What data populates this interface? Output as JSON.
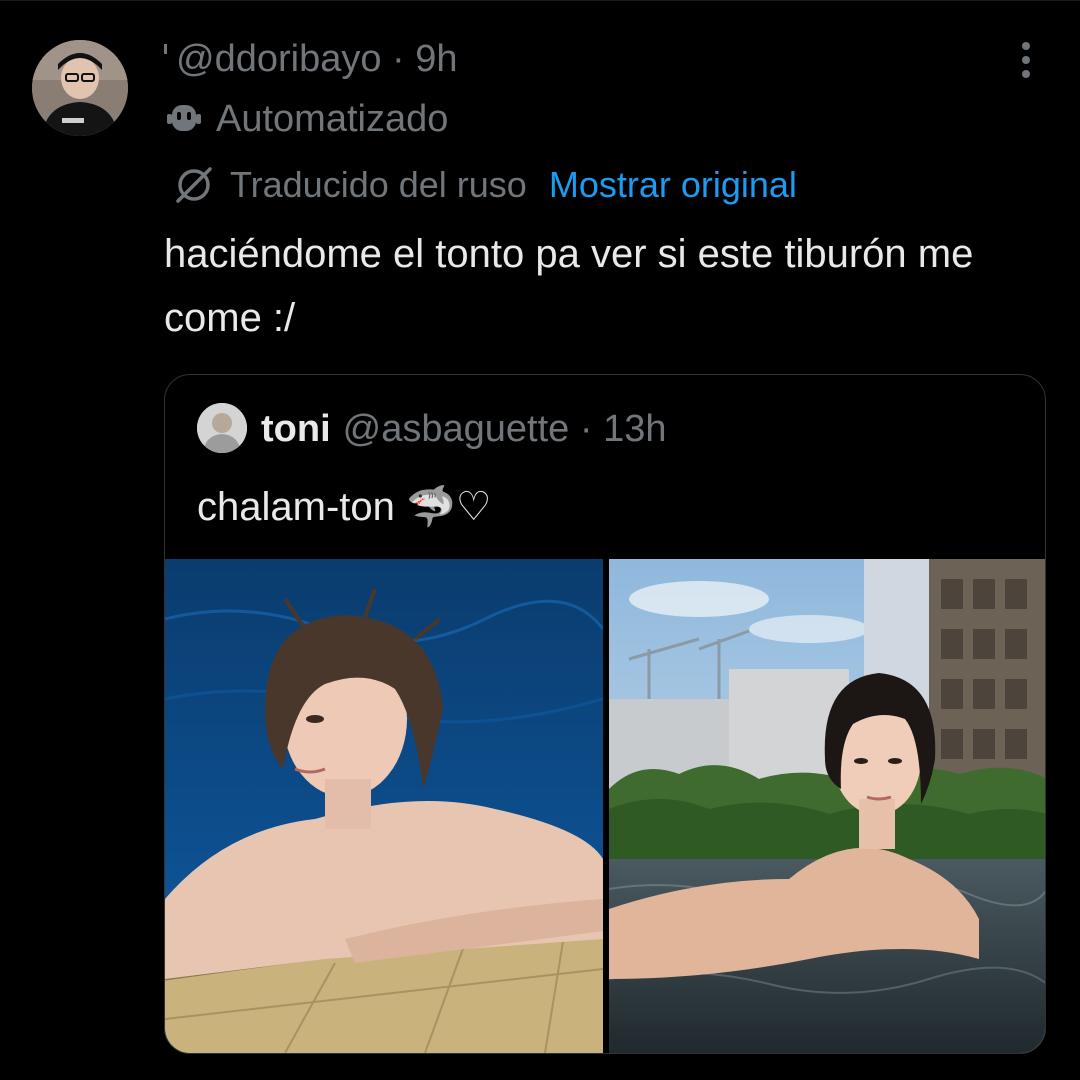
{
  "tweet": {
    "handle": "@ddoribayo",
    "separator": "·",
    "time": "9h",
    "automated_label": "Automatizado",
    "translation_notice": "Traducido del ruso",
    "show_original_link": "Mostrar original",
    "text": "haciéndome el tonto pa ver si este tiburón me come :/",
    "icons": {
      "automated": "robot-icon",
      "translation": "globe-slash-icon",
      "more": "more-vertical-icon"
    }
  },
  "quote": {
    "name": "toni",
    "handle": "@asbaguette",
    "separator": "·",
    "time": "13h",
    "text": "chalam-ton 🦈♡",
    "media": [
      "photo-swimming-pool",
      "photo-rooftop-pool"
    ]
  },
  "colors": {
    "background": "#000000",
    "text_primary": "#e7e9ea",
    "text_secondary": "#71767b",
    "link": "#1d9bf0",
    "card_border": "#2f3336"
  }
}
